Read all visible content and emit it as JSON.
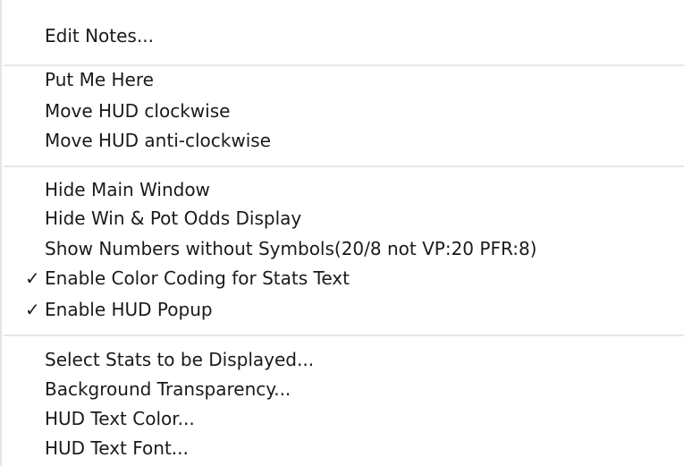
{
  "menu": {
    "groups": [
      {
        "items": [
          {
            "label": "Edit Notes...",
            "checked": false
          }
        ]
      },
      {
        "items": [
          {
            "label": "Put Me Here",
            "checked": false
          },
          {
            "label": "Move HUD clockwise",
            "checked": false
          },
          {
            "label": "Move HUD anti-clockwise",
            "checked": false
          }
        ]
      },
      {
        "items": [
          {
            "label": "Hide Main Window",
            "checked": false
          },
          {
            "label": "Hide Win & Pot Odds Display",
            "checked": false
          },
          {
            "label": "Show Numbers without Symbols(20/8 not VP:20 PFR:8)",
            "checked": false
          },
          {
            "label": "Enable Color Coding for Stats Text",
            "checked": true
          },
          {
            "label": "Enable HUD Popup",
            "checked": true
          }
        ]
      },
      {
        "items": [
          {
            "label": "Select Stats to be Displayed...",
            "checked": false
          },
          {
            "label": "Background Transparency...",
            "checked": false
          },
          {
            "label": "HUD Text Color...",
            "checked": false
          },
          {
            "label": "HUD Text Font...",
            "checked": false
          }
        ]
      }
    ],
    "check_glyph": "✓"
  }
}
